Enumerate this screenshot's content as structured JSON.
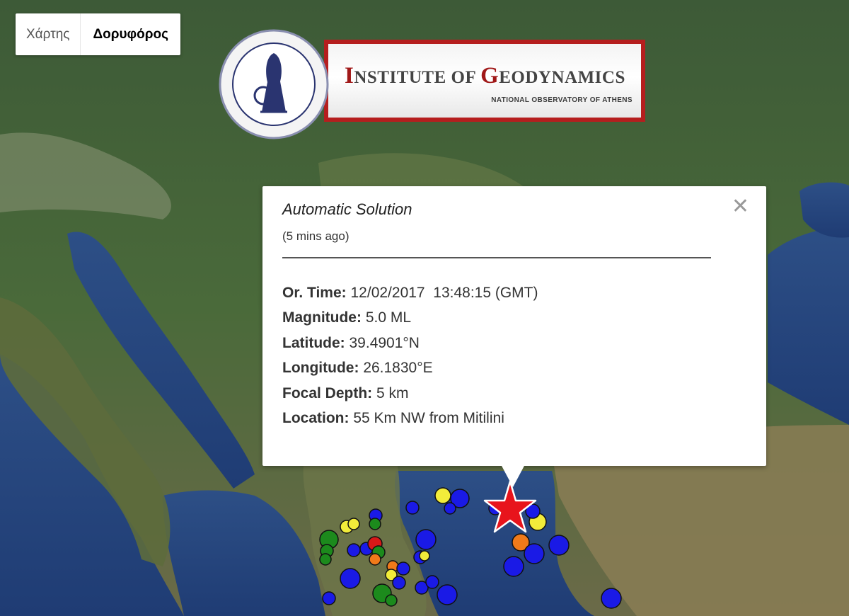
{
  "map_type_control": {
    "map_label": "Χάρτης",
    "satellite_label": "Δορυφόρος",
    "selected": "satellite"
  },
  "logo": {
    "title_first_cap": "I",
    "title_first_rest": "NSTITUTE OF ",
    "title_second_cap": "G",
    "title_second_rest": "EODYNAMICS",
    "subtitle": "NATIONAL OBSERVATORY OF ATHENS",
    "accent_color": "#b51e1e"
  },
  "popup": {
    "title": "Automatic Solution",
    "ago": "(5 mins ago)",
    "close_icon": "close-icon",
    "rows": [
      {
        "label": "Or. Time:",
        "value": "12/02/2017  13:48:15 (GMT)"
      },
      {
        "label": "Magnitude:",
        "value": "5.0 ML"
      },
      {
        "label": "Latitude:",
        "value": "39.4901°N"
      },
      {
        "label": "Longitude:",
        "value": "26.1830°E"
      },
      {
        "label": "Focal Depth:",
        "value": "5 km"
      },
      {
        "label": "Location:",
        "value": "55 Km NW from Mitilini"
      }
    ]
  },
  "epicenter": {
    "icon": "star-icon",
    "color": "#e8141c"
  },
  "marker_colors": {
    "blue": "#1a1ae6",
    "yellow": "#f2ec3a",
    "green": "#1c8a1c",
    "orange": "#f07a1a",
    "red": "#d81818"
  }
}
